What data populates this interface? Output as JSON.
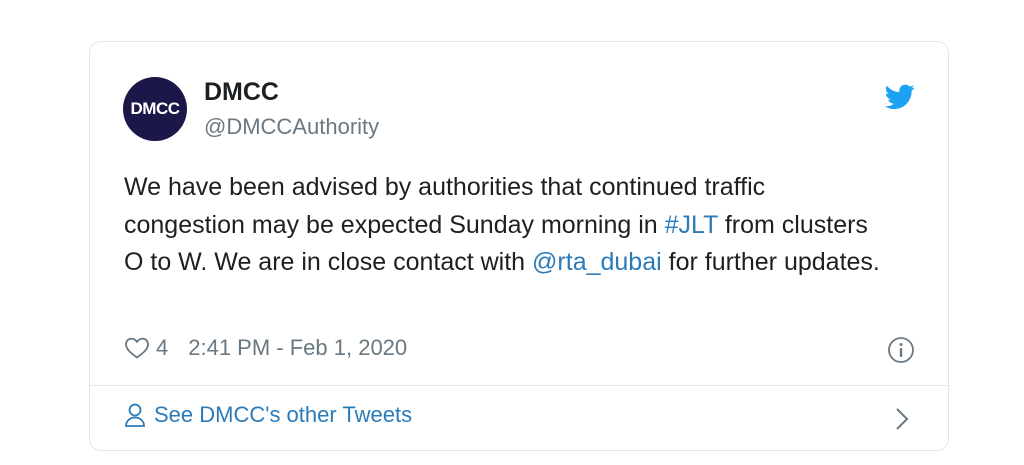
{
  "tweet": {
    "avatar_text": "DMCC",
    "display_name": "DMCC",
    "handle": "@DMCCAuthority",
    "text_parts": {
      "p1": "We have been advised by authorities that continued traffic congestion may be expected Sunday morning in ",
      "hashtag": "#JLT",
      "p2": " from clusters O to W. We are in close contact with ",
      "mention": "@rta_dubai",
      "p3": " for further updates."
    },
    "like_count": "4",
    "timestamp": "2:41 PM - Feb 1, 2020",
    "footer_label": "See DMCC's other Tweets"
  },
  "icons": {
    "brand": "twitter-bird-icon",
    "like": "heart-icon",
    "info": "info-icon",
    "profile": "person-icon",
    "next": "chevron-right-icon"
  },
  "colors": {
    "link": "#2b7bb9",
    "twitter_blue": "#1da1f2",
    "avatar_bg": "#1b1748",
    "muted": "#697882",
    "border": "#e1e8ed"
  }
}
